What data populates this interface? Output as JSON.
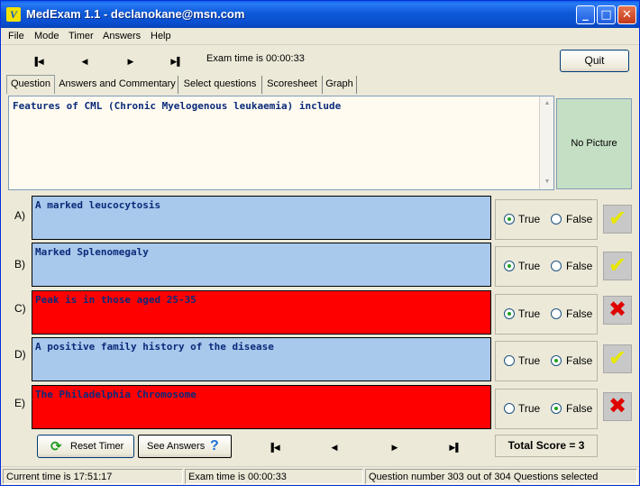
{
  "window": {
    "app_icon": "V",
    "title": "MedExam 1.1 - declanokane@msn.com",
    "minimize_glyph": "_",
    "maximize_glyph": "□",
    "close_glyph": "✕"
  },
  "menu": [
    {
      "label": "File"
    },
    {
      "label": "Mode"
    },
    {
      "label": "Timer"
    },
    {
      "label": "Answers"
    },
    {
      "label": "Help"
    }
  ],
  "toolbar": {
    "first_glyph": "▐◀",
    "prev_glyph": "◀",
    "next_glyph": "▶",
    "last_glyph": "▶▌",
    "exam_time": "Exam time is 00:00:33",
    "quit_label": "Quit"
  },
  "tabs": [
    {
      "label": "Question",
      "active": true
    },
    {
      "label": "Answers and Commentary"
    },
    {
      "label": "Select questions"
    },
    {
      "label": "Scoresheet"
    },
    {
      "label": "Graph"
    }
  ],
  "question": {
    "text": "Features of CML (Chronic Myelogenous leukaemia) include",
    "picture_placeholder": "No Picture",
    "scroll_up": "▲",
    "scroll_down": "▼"
  },
  "options": [
    {
      "letter": "A)",
      "text": "A marked leucocytosis",
      "box_color": "blue",
      "selected": "true",
      "result": "correct"
    },
    {
      "letter": "B)",
      "text": "Marked Splenomegaly",
      "box_color": "blue",
      "selected": "true",
      "result": "correct"
    },
    {
      "letter": "C)",
      "text": "Peak is in those aged 25-35",
      "box_color": "red",
      "selected": "true",
      "result": "incorrect"
    },
    {
      "letter": "D)",
      "text": "A positive family history of the disease",
      "box_color": "blue",
      "selected": "false",
      "result": "correct"
    },
    {
      "letter": "E)",
      "text": "The Philadelphia Chromosome",
      "box_color": "red",
      "selected": "false",
      "result": "incorrect"
    }
  ],
  "answer_labels": {
    "true": "True",
    "false": "False"
  },
  "result_glyphs": {
    "correct": "✔",
    "incorrect": "✖"
  },
  "bottom": {
    "reset_icon": "⟳",
    "reset_label": "Reset Timer",
    "see_answers_label": "See Answers",
    "help_glyph": "?",
    "first_glyph": "▐◀",
    "prev_glyph": "◀",
    "next_glyph": "▶",
    "last_glyph": "▶▌",
    "total_score": "Total Score = 3"
  },
  "status": {
    "current_time": "Current time is 17:51:17",
    "exam_time": "Exam time is 00:00:33",
    "question_info": "Question number 303 out of 304 Questions selected"
  },
  "colors": {
    "correct_box": "#a8c8ec",
    "incorrect_box": "#ff0000",
    "tick": "#e8e800",
    "cross": "#e00000",
    "picture_bg": "#c5dfc5"
  }
}
